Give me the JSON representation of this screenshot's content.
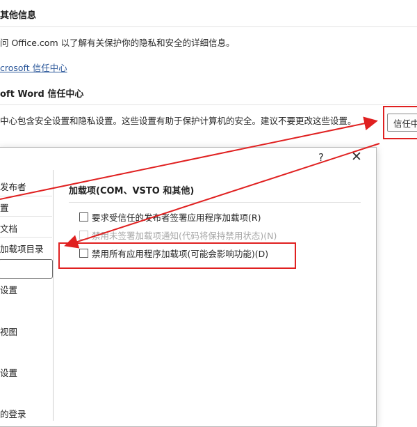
{
  "privacy": {
    "header": "其他信息",
    "desc_prefix": "问 Office.com 以了解有关保护你的隐私和安全的详细信息。",
    "link": "crosoft 信任中心"
  },
  "trust_center": {
    "header": "oft Word 信任中心",
    "desc": "中心包含安全设置和隐私设置。这些设置有助于保护计算机的安全。建议不要更改这些设置。",
    "button": "信任中"
  },
  "dialog": {
    "help": "?",
    "close": "✕",
    "nav_items": [
      "发布者",
      "置",
      "文档",
      "加载项目录",
      "",
      "设置",
      "视图",
      "设置",
      "的登录"
    ],
    "section_title": "加载项(COM、VSTO 和其他)",
    "options": [
      {
        "label": "要求受信任的发布者签署应用程序加载项(R)",
        "checked": false,
        "disabled": false
      },
      {
        "label": "禁用未签署加载项通知(代码将保持禁用状态)(N)",
        "checked": false,
        "disabled": true
      },
      {
        "label": "禁用所有应用程序加载项(可能会影响功能)(D)",
        "checked": false,
        "disabled": false
      }
    ]
  },
  "colors": {
    "annotation_red": "#e02020",
    "link_blue": "#2b579a"
  }
}
